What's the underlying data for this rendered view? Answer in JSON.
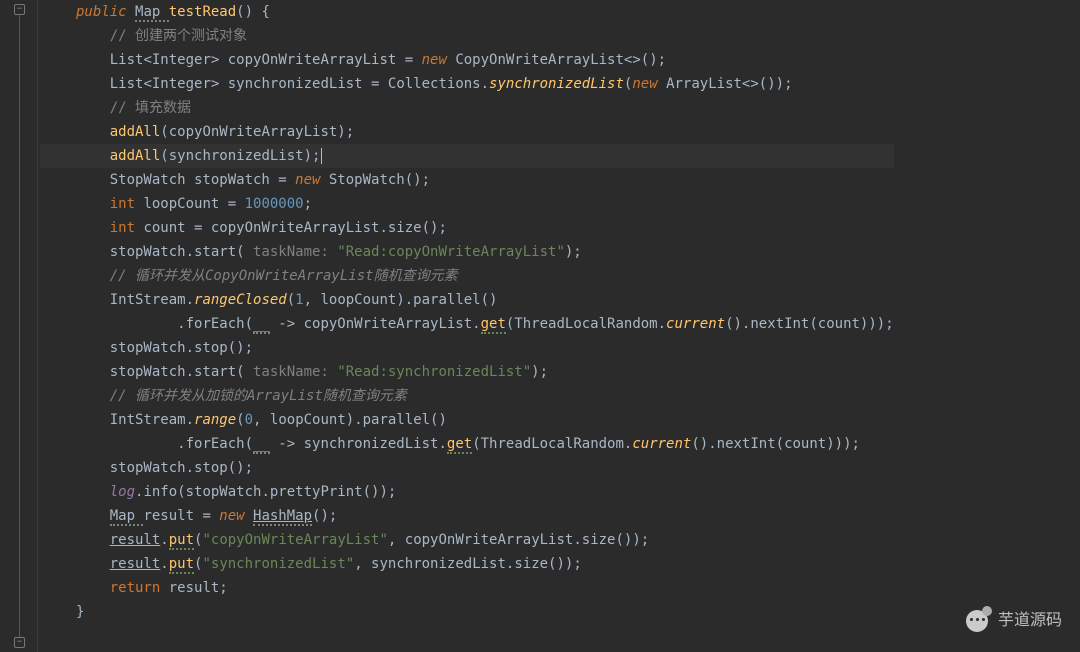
{
  "code": {
    "lines": [
      {
        "indent": 0,
        "hl": false,
        "segs": [
          {
            "t": "public ",
            "c": "kw"
          },
          {
            "t": "Map ",
            "c": "squig-gray type"
          },
          {
            "t": "testRead",
            "c": "method"
          },
          {
            "t": "() {",
            "c": "punc"
          }
        ]
      },
      {
        "indent": 1,
        "hl": false,
        "segs": [
          {
            "t": "// 创建两个测试对象",
            "c": "cmt"
          }
        ]
      },
      {
        "indent": 1,
        "hl": false,
        "segs": [
          {
            "t": "List",
            "c": "type"
          },
          {
            "t": "<",
            "c": "punc"
          },
          {
            "t": "Integer",
            "c": "type"
          },
          {
            "t": "> copyOnWriteArrayList = ",
            "c": "punc"
          },
          {
            "t": "new ",
            "c": "kw"
          },
          {
            "t": "CopyOnWriteArrayList",
            "c": "type"
          },
          {
            "t": "<>();",
            "c": "punc"
          }
        ]
      },
      {
        "indent": 1,
        "hl": false,
        "segs": [
          {
            "t": "List",
            "c": "type"
          },
          {
            "t": "<",
            "c": "punc"
          },
          {
            "t": "Integer",
            "c": "type"
          },
          {
            "t": "> synchronizedList = Collections.",
            "c": "punc"
          },
          {
            "t": "synchronizedList",
            "c": "methodItalic"
          },
          {
            "t": "(",
            "c": "punc"
          },
          {
            "t": "new ",
            "c": "kw"
          },
          {
            "t": "ArrayList",
            "c": "type"
          },
          {
            "t": "<>());",
            "c": "punc"
          }
        ]
      },
      {
        "indent": 1,
        "hl": false,
        "segs": [
          {
            "t": "// 填充数据",
            "c": "cmt"
          }
        ]
      },
      {
        "indent": 1,
        "hl": false,
        "segs": [
          {
            "t": "addAll",
            "c": "method"
          },
          {
            "t": "(copyOnWriteArrayList);",
            "c": "punc"
          }
        ]
      },
      {
        "indent": 1,
        "hl": true,
        "segs": [
          {
            "t": "addAll",
            "c": "method"
          },
          {
            "t": "(synchronizedList);",
            "c": "punc"
          },
          {
            "t": "",
            "c": "caret"
          }
        ]
      },
      {
        "indent": 1,
        "hl": false,
        "segs": [
          {
            "t": "StopWatch stopWatch = ",
            "c": "punc"
          },
          {
            "t": "new ",
            "c": "kw"
          },
          {
            "t": "StopWatch();",
            "c": "punc"
          }
        ]
      },
      {
        "indent": 1,
        "hl": false,
        "segs": [
          {
            "t": "int ",
            "c": "kw2"
          },
          {
            "t": "loopCount = ",
            "c": "punc"
          },
          {
            "t": "1000000",
            "c": "num"
          },
          {
            "t": ";",
            "c": "punc"
          }
        ]
      },
      {
        "indent": 1,
        "hl": false,
        "segs": [
          {
            "t": "int ",
            "c": "kw2"
          },
          {
            "t": "count = copyOnWriteArrayList.size();",
            "c": "punc"
          }
        ]
      },
      {
        "indent": 1,
        "hl": false,
        "segs": [
          {
            "t": "stopWatch.start(",
            "c": "punc"
          },
          {
            "t": " taskName: ",
            "c": "param"
          },
          {
            "t": "\"Read:copyOnWriteArrayList\"",
            "c": "str"
          },
          {
            "t": ");",
            "c": "punc"
          }
        ]
      },
      {
        "indent": 1,
        "hl": false,
        "segs": [
          {
            "t": "// 循环并发从CopyOnWriteArrayList随机查询元素",
            "c": "cmtIt"
          }
        ]
      },
      {
        "indent": 1,
        "hl": false,
        "segs": [
          {
            "t": "IntStream.",
            "c": "punc"
          },
          {
            "t": "rangeClosed",
            "c": "methodItalic"
          },
          {
            "t": "(",
            "c": "punc"
          },
          {
            "t": "1",
            "c": "num"
          },
          {
            "t": ", loopCount).parallel()",
            "c": "punc"
          }
        ]
      },
      {
        "indent": 3,
        "hl": false,
        "segs": [
          {
            "t": ".forEach(",
            "c": "punc"
          },
          {
            "t": "__",
            "c": "squig-gray"
          },
          {
            "t": " -> copyOnWriteArrayList.",
            "c": "punc"
          },
          {
            "t": "get",
            "c": "method squig-green"
          },
          {
            "t": "(ThreadLocalRandom.",
            "c": "punc"
          },
          {
            "t": "current",
            "c": "methodItalic"
          },
          {
            "t": "().nextInt(count)));",
            "c": "punc"
          }
        ]
      },
      {
        "indent": 1,
        "hl": false,
        "segs": [
          {
            "t": "stopWatch.stop();",
            "c": "punc"
          }
        ]
      },
      {
        "indent": 1,
        "hl": false,
        "segs": [
          {
            "t": "stopWatch.start(",
            "c": "punc"
          },
          {
            "t": " taskName: ",
            "c": "param"
          },
          {
            "t": "\"Read:synchronizedList\"",
            "c": "str"
          },
          {
            "t": ");",
            "c": "punc"
          }
        ]
      },
      {
        "indent": 1,
        "hl": false,
        "segs": [
          {
            "t": "// 循环并发从加锁的ArrayList随机查询元素",
            "c": "cmtIt"
          }
        ]
      },
      {
        "indent": 1,
        "hl": false,
        "segs": [
          {
            "t": "IntStream.",
            "c": "punc"
          },
          {
            "t": "range",
            "c": "methodItalic"
          },
          {
            "t": "(",
            "c": "punc"
          },
          {
            "t": "0",
            "c": "num"
          },
          {
            "t": ", loopCount).parallel()",
            "c": "punc"
          }
        ]
      },
      {
        "indent": 3,
        "hl": false,
        "segs": [
          {
            "t": ".forEach(",
            "c": "punc"
          },
          {
            "t": "__",
            "c": "squig-gray"
          },
          {
            "t": " -> synchronizedList.",
            "c": "punc"
          },
          {
            "t": "get",
            "c": "method squig-green"
          },
          {
            "t": "(ThreadLocalRandom.",
            "c": "punc"
          },
          {
            "t": "current",
            "c": "methodItalic"
          },
          {
            "t": "().nextInt(count)));",
            "c": "punc"
          }
        ]
      },
      {
        "indent": 1,
        "hl": false,
        "segs": [
          {
            "t": "stopWatch.stop();",
            "c": "punc"
          }
        ]
      },
      {
        "indent": 1,
        "hl": false,
        "segs": [
          {
            "t": "log",
            "c": "field"
          },
          {
            "t": ".info(stopWatch.prettyPrint());",
            "c": "punc"
          }
        ]
      },
      {
        "indent": 1,
        "hl": false,
        "segs": [
          {
            "t": "Map ",
            "c": "squig-gray type"
          },
          {
            "t": "result = ",
            "c": "punc"
          },
          {
            "t": "new ",
            "c": "kw"
          },
          {
            "t": "HashMap",
            "c": "squig-gray underline type"
          },
          {
            "t": "();",
            "c": "punc"
          }
        ]
      },
      {
        "indent": 1,
        "hl": false,
        "segs": [
          {
            "t": "result",
            "c": "underline"
          },
          {
            "t": ".",
            "c": "punc"
          },
          {
            "t": "put",
            "c": "method squig-green"
          },
          {
            "t": "(",
            "c": "punc"
          },
          {
            "t": "\"copyOnWriteArrayList\"",
            "c": "str"
          },
          {
            "t": ", copyOnWriteArrayList.size());",
            "c": "punc"
          }
        ]
      },
      {
        "indent": 1,
        "hl": false,
        "segs": [
          {
            "t": "result",
            "c": "underline"
          },
          {
            "t": ".",
            "c": "punc"
          },
          {
            "t": "put",
            "c": "method squig-green"
          },
          {
            "t": "(",
            "c": "punc"
          },
          {
            "t": "\"synchronizedList\"",
            "c": "str"
          },
          {
            "t": ", synchronizedList.size());",
            "c": "punc"
          }
        ]
      },
      {
        "indent": 1,
        "hl": false,
        "segs": [
          {
            "t": "return ",
            "c": "kw2"
          },
          {
            "t": "result;",
            "c": "punc"
          }
        ]
      },
      {
        "indent": 0,
        "hl": false,
        "segs": [
          {
            "t": "}",
            "c": "punc"
          }
        ]
      }
    ]
  },
  "watermark": {
    "text": "芋道源码"
  }
}
